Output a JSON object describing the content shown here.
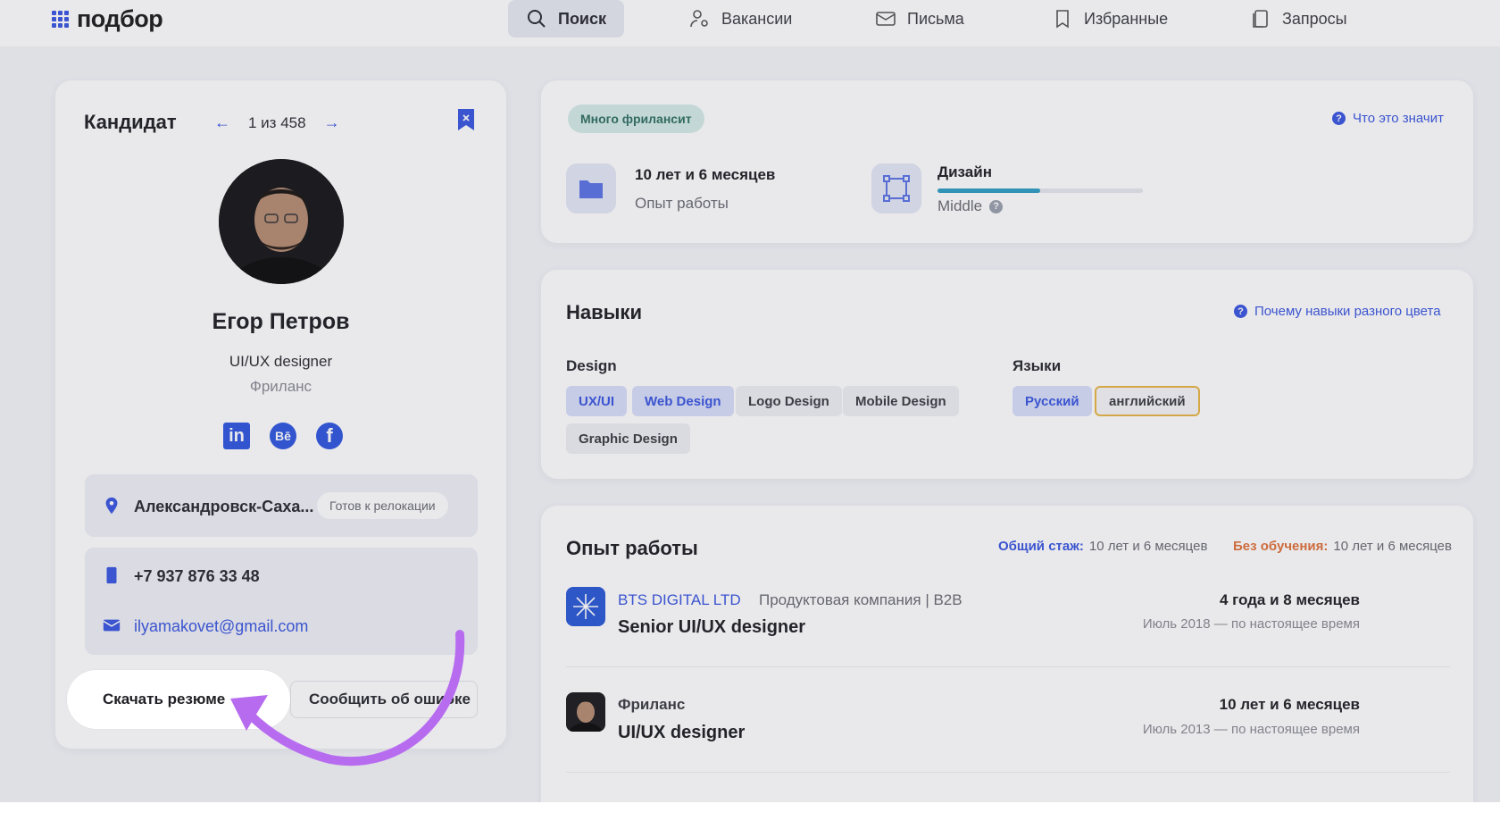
{
  "app": {
    "logo_text": "подбор"
  },
  "nav": [
    {
      "label": "Поиск",
      "icon": "search-icon"
    },
    {
      "label": "Вакансии",
      "icon": "user-gear-icon"
    },
    {
      "label": "Письма",
      "icon": "mail-icon"
    },
    {
      "label": "Избранные",
      "icon": "bookmark-icon"
    },
    {
      "label": "Запросы",
      "icon": "documents-icon"
    }
  ],
  "candidate": {
    "title": "Кандидат",
    "pager": "1 из 458",
    "name": "Егор Петров",
    "role": "UI/UX designer",
    "employment": "Фриланс",
    "socials": [
      {
        "name": "linkedin-icon",
        "glyph": "in"
      },
      {
        "name": "behance-icon",
        "glyph": "Bē"
      },
      {
        "name": "facebook-icon",
        "glyph": "f"
      }
    ],
    "location": "Александровск-Саха...",
    "relocation": "Готов к релокации",
    "phone": "+7 937 876 33 48",
    "email": "ilyamakovet@gmail.com",
    "download_label": "Скачать резюме",
    "report_label": "Сообщить об ошибке"
  },
  "summary": {
    "tag": "Много фрилансит",
    "help_link": "Что это значит",
    "experience_value": "10 лет и 6 месяцев",
    "experience_label": "Опыт работы",
    "spec_name": "Дизайн",
    "spec_level": "Middle",
    "spec_progress": 0.5
  },
  "skills": {
    "title": "Навыки",
    "help_link": "Почему навыки разного цвета",
    "design_title": "Design",
    "design": [
      "UX/UI",
      "Web Design",
      "Logo Design",
      "Mobile Design",
      "Graphic Design"
    ],
    "languages_title": "Языки",
    "languages": [
      "Русский",
      "английский"
    ]
  },
  "experience": {
    "title": "Опыт работы",
    "total_label": "Общий стаж:",
    "total_value": "10 лет и 6 месяцев",
    "noedu_label": "Без обучения:",
    "noedu_value": "10 лет и 6 месяцев",
    "jobs": [
      {
        "company": "BTS DIGITAL LTD",
        "meta": "Продуктовая компания | B2B",
        "title": "Senior UI/UX designer",
        "duration": "4 года и 8 месяцев",
        "period": "Июль 2018 — по настоящее время"
      },
      {
        "company": "Фриланс",
        "meta": "",
        "title": "UI/UX designer",
        "duration": "10 лет и 6 месяцев",
        "period": "Июль 2013 — по настоящее время"
      }
    ]
  },
  "colors": {
    "accent": "#3a56e0",
    "warning": "#e0713a",
    "highlight_arrow": "#b76cf0"
  }
}
